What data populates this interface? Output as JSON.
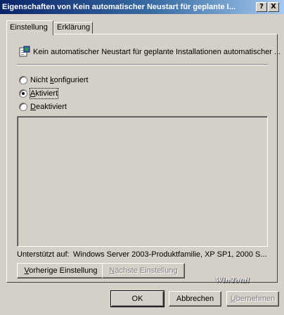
{
  "window": {
    "title": "Eigenschaften von Kein automatischer Neustart für geplante I...",
    "help_label": "?",
    "close_label": "X"
  },
  "tabs": [
    {
      "label": "Einstellung",
      "selected": true
    },
    {
      "label": "Erklärung",
      "selected": false
    }
  ],
  "policy": {
    "title": "Kein automatischer Neustart für geplante Installationen automatischer ...",
    "icon": "policy-setting-icon"
  },
  "options": [
    {
      "label": "Nicht konfiguriert",
      "selected": false
    },
    {
      "label": "Aktiviert",
      "selected": true
    },
    {
      "label": "Deaktiviert",
      "selected": false
    }
  ],
  "supported": {
    "label": "Unterstützt auf:",
    "value": "Windows Server 2003-Produktfamilie, XP SP1, 2000 S..."
  },
  "nav_buttons": {
    "previous": "Vorherige Einstellung",
    "next": "Nächste Einstellung"
  },
  "watermark": "WinTotal",
  "dialog_buttons": {
    "ok": "OK",
    "cancel": "Abbrechen",
    "apply": "Übernehmen"
  },
  "colors": {
    "title_start": "#0a246a",
    "title_end": "#a6caf0",
    "face": "#d4d0c8"
  }
}
